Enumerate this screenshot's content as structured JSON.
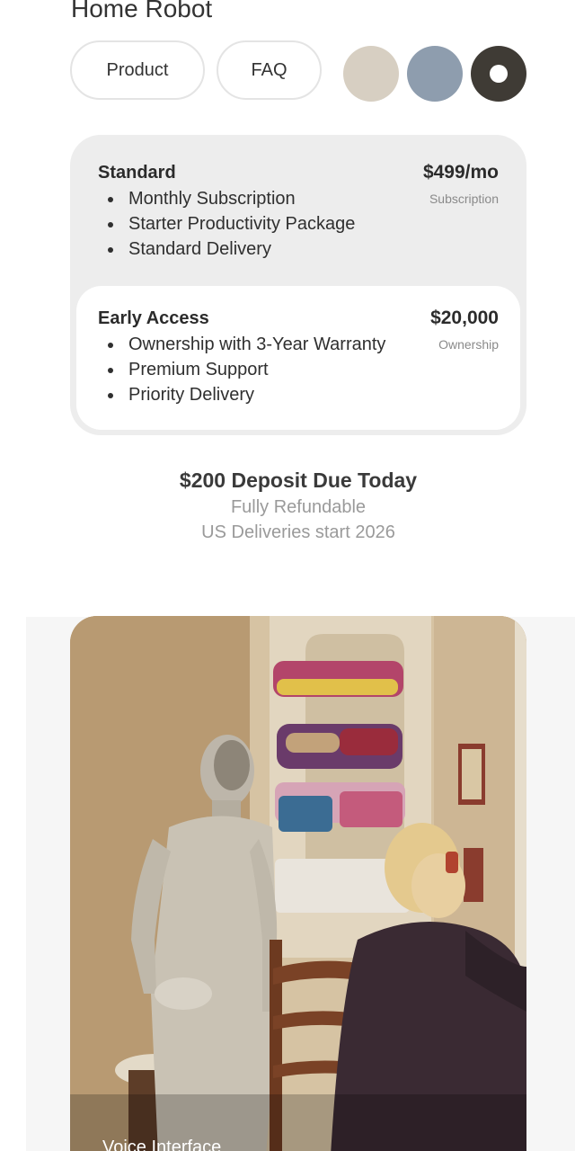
{
  "header": {
    "title": "Home Robot"
  },
  "tabs": [
    {
      "label": "Product"
    },
    {
      "label": "FAQ"
    }
  ],
  "color_options": [
    {
      "name": "sand",
      "color": "#d7cfc2"
    },
    {
      "name": "slate",
      "color": "#8e9dae"
    },
    {
      "name": "charcoal",
      "color": "#3f3b35",
      "selected": true
    }
  ],
  "plans": {
    "standard": {
      "title": "Standard",
      "price": "$499/mo",
      "type": "Subscription",
      "features": [
        "Monthly Subscription",
        "Starter Productivity Package",
        "Standard Delivery"
      ]
    },
    "early_access": {
      "title": "Early Access",
      "price": "$20,000",
      "type": "Ownership",
      "features": [
        "Ownership with 3-Year Warranty",
        "Premium Support",
        "Priority Delivery"
      ],
      "selected": true
    }
  },
  "deposit": {
    "headline": "$200 Deposit Due Today",
    "refund_note": "Fully Refundable",
    "delivery_note": "US Deliveries start 2026"
  },
  "gallery": {
    "caption": "Voice Interface"
  }
}
